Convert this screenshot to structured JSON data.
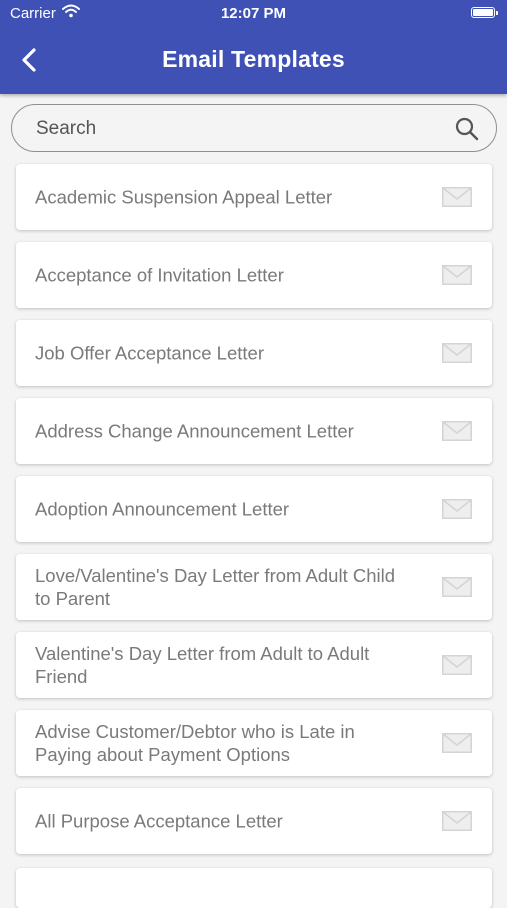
{
  "status_bar": {
    "carrier": "Carrier",
    "time": "12:07 PM"
  },
  "header": {
    "title": "Email Templates",
    "back_icon": "chevron-left-icon",
    "background_color": "#3f51b5"
  },
  "search": {
    "placeholder": "Search",
    "value": "",
    "icon": "search-icon"
  },
  "templates": [
    {
      "label": "Academic Suspension Appeal Letter",
      "icon": "envelope-icon"
    },
    {
      "label": "Acceptance of Invitation Letter",
      "icon": "envelope-icon"
    },
    {
      "label": "Job Offer Acceptance Letter",
      "icon": "envelope-icon"
    },
    {
      "label": "Address Change Announcement Letter",
      "icon": "envelope-icon"
    },
    {
      "label": "Adoption Announcement Letter",
      "icon": "envelope-icon"
    },
    {
      "label": "Love/Valentine's Day Letter from Adult Child to Parent",
      "icon": "envelope-icon"
    },
    {
      "label": "Valentine's Day Letter from Adult to Adult Friend",
      "icon": "envelope-icon"
    },
    {
      "label": "Advise Customer/Debtor who is Late in Paying about Payment Options",
      "icon": "envelope-icon"
    },
    {
      "label": "All Purpose Acceptance Letter",
      "icon": "envelope-icon"
    }
  ]
}
